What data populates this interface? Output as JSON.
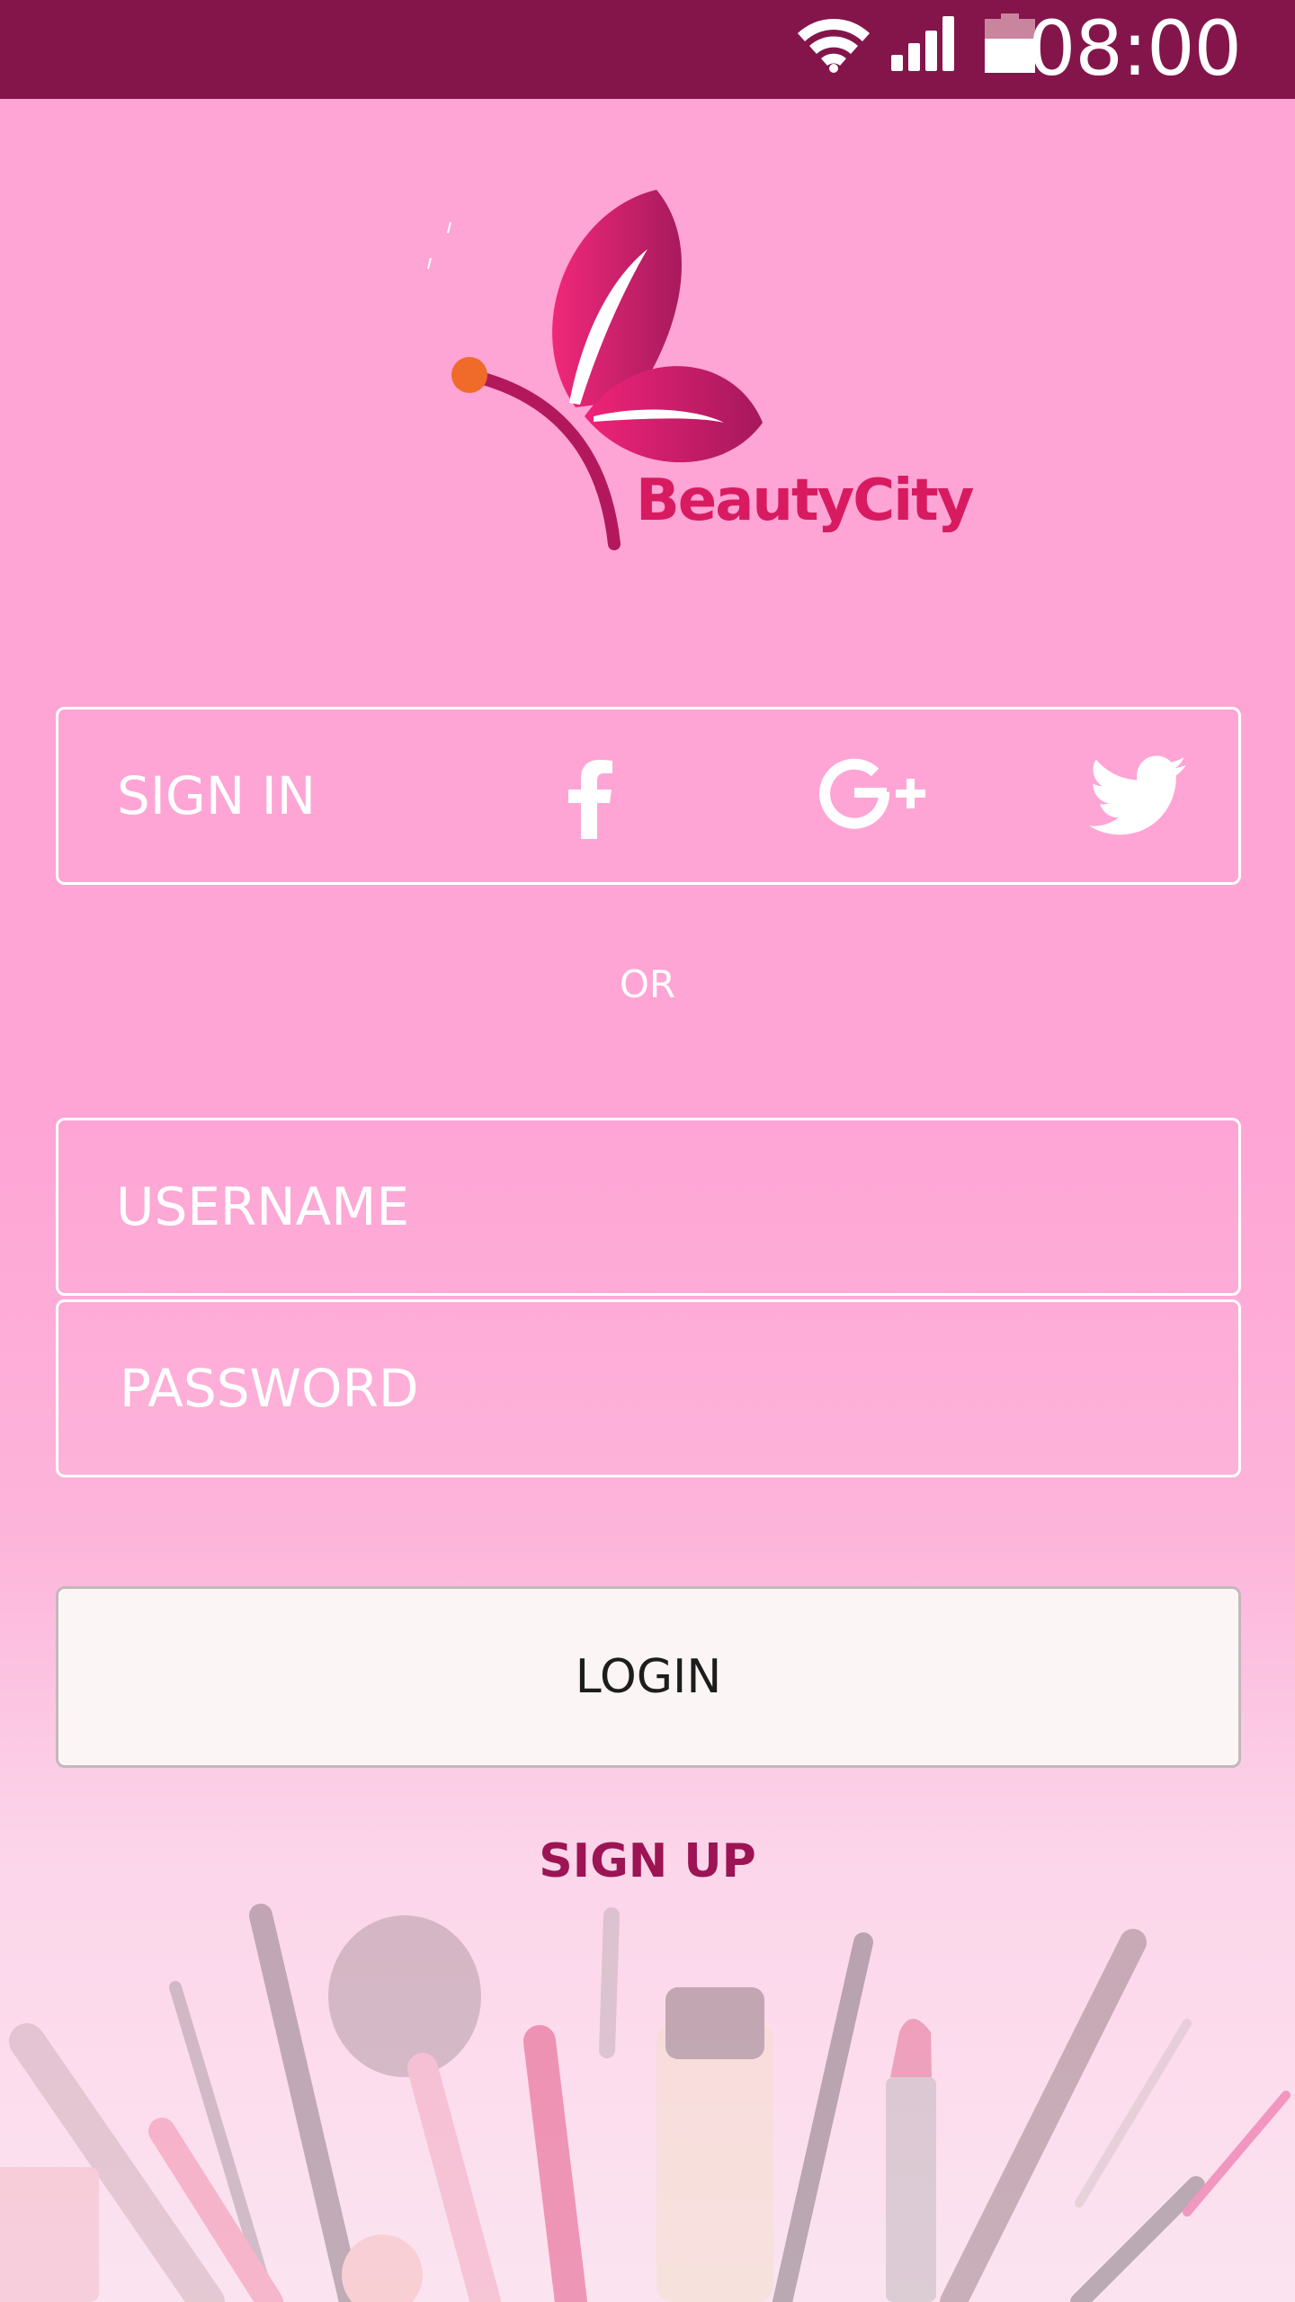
{
  "status_bar": {
    "time": "08:00",
    "icons": [
      "wifi-icon",
      "signal-icon",
      "battery-icon"
    ],
    "background": "#84154b"
  },
  "logo": {
    "brand": "BeautyCity",
    "icon": "butterfly-logo-icon",
    "color": "#d81b60"
  },
  "signin": {
    "label": "SIGN IN",
    "providers": [
      {
        "name": "facebook",
        "icon": "facebook-icon"
      },
      {
        "name": "google-plus",
        "icon": "google-plus-icon"
      },
      {
        "name": "twitter",
        "icon": "twitter-icon"
      }
    ]
  },
  "divider": {
    "text": "OR"
  },
  "form": {
    "username_placeholder": "USERNAME",
    "password_placeholder": "PASSWORD",
    "login_label": "LOGIN",
    "signup_label": "SIGN UP"
  },
  "colors": {
    "background": "#fea5d5",
    "accent": "#9c1453",
    "button_bg": "#fbf6f5"
  }
}
